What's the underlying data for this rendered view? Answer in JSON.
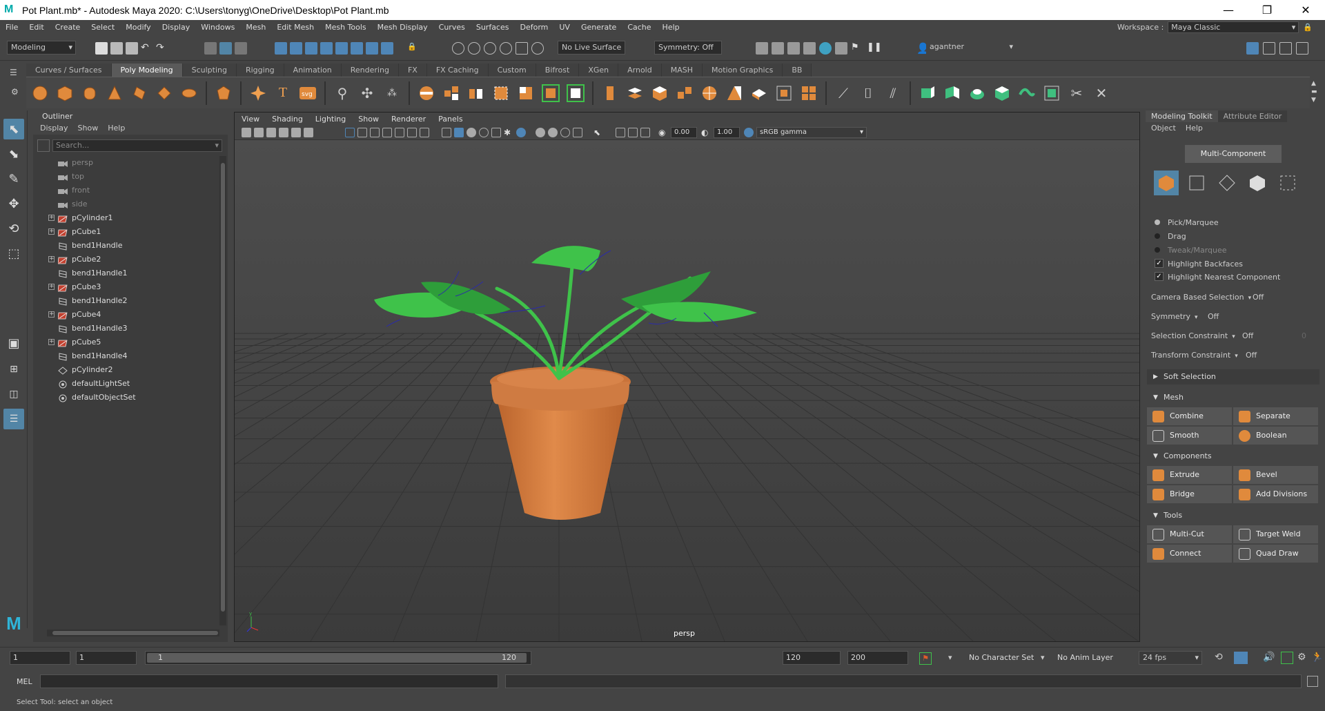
{
  "window": {
    "title": "Pot Plant.mb* - Autodesk Maya 2020: C:\\Users\\tonyg\\OneDrive\\Desktop\\Pot Plant.mb",
    "minimize": "—",
    "maximize": "❐",
    "close": "✕"
  },
  "main_menu": [
    "File",
    "Edit",
    "Create",
    "Select",
    "Modify",
    "Display",
    "Windows",
    "Mesh",
    "Edit Mesh",
    "Mesh Tools",
    "Mesh Display",
    "Curves",
    "Surfaces",
    "Deform",
    "UV",
    "Generate",
    "Cache",
    "Help"
  ],
  "workspace": {
    "label": "Workspace :",
    "value": "Maya Classic"
  },
  "status_line": {
    "menu_set": "Modeling",
    "live_surface": "No Live Surface",
    "symmetry": "Symmetry: Off",
    "user": "agantner"
  },
  "shelf_tabs": [
    "Curves / Surfaces",
    "Poly Modeling",
    "Sculpting",
    "Rigging",
    "Animation",
    "Rendering",
    "FX",
    "FX Caching",
    "Custom",
    "Bifrost",
    "XGen",
    "Arnold",
    "MASH",
    "Motion Graphics",
    "BB"
  ],
  "shelf_active_tab": "Poly Modeling",
  "outliner": {
    "title": "Outliner",
    "menu": [
      "Display",
      "Show",
      "Help"
    ],
    "search_placeholder": "Search...",
    "items": [
      {
        "label": "persp",
        "type": "camera",
        "expand": false
      },
      {
        "label": "top",
        "type": "camera",
        "expand": false
      },
      {
        "label": "front",
        "type": "camera",
        "expand": false
      },
      {
        "label": "side",
        "type": "camera",
        "expand": false
      },
      {
        "label": "pCylinder1",
        "type": "mesh",
        "expand": true
      },
      {
        "label": "pCube1",
        "type": "mesh",
        "expand": true
      },
      {
        "label": "bend1Handle",
        "type": "handle",
        "expand": false
      },
      {
        "label": "pCube2",
        "type": "mesh",
        "expand": true
      },
      {
        "label": "bend1Handle1",
        "type": "handle",
        "expand": false
      },
      {
        "label": "pCube3",
        "type": "mesh",
        "expand": true
      },
      {
        "label": "bend1Handle2",
        "type": "handle",
        "expand": false
      },
      {
        "label": "pCube4",
        "type": "mesh",
        "expand": true
      },
      {
        "label": "bend1Handle3",
        "type": "handle",
        "expand": false
      },
      {
        "label": "pCube5",
        "type": "mesh",
        "expand": true
      },
      {
        "label": "bend1Handle4",
        "type": "handle",
        "expand": false
      },
      {
        "label": "pCylinder2",
        "type": "group",
        "expand": false
      },
      {
        "label": "defaultLightSet",
        "type": "set",
        "expand": false
      },
      {
        "label": "defaultObjectSet",
        "type": "set",
        "expand": false
      }
    ]
  },
  "viewport": {
    "menu": [
      "View",
      "Shading",
      "Lighting",
      "Show",
      "Renderer",
      "Panels"
    ],
    "exposure": "0.00",
    "gamma": "1.00",
    "color_space": "sRGB gamma",
    "camera_label": "persp"
  },
  "toolkit": {
    "tabs": [
      "Modeling Toolkit",
      "Attribute Editor"
    ],
    "menu": [
      "Object",
      "Help"
    ],
    "multi_component": "Multi-Component",
    "pick_modes": [
      "Pick/Marquee",
      "Drag",
      "Tweak/Marquee"
    ],
    "checks": [
      "Highlight Backfaces",
      "Highlight Nearest Component"
    ],
    "options": [
      {
        "label": "Camera Based Selection",
        "value": "Off"
      },
      {
        "label": "Symmetry",
        "value": "Off"
      },
      {
        "label": "Selection Constraint",
        "value": "Off",
        "extra": "0"
      },
      {
        "label": "Transform Constraint",
        "value": "Off"
      }
    ],
    "soft_selection": "Soft Selection",
    "sections": {
      "mesh": {
        "title": "Mesh",
        "buttons": [
          "Combine",
          "Separate",
          "Smooth",
          "Boolean"
        ]
      },
      "components": {
        "title": "Components",
        "buttons": [
          "Extrude",
          "Bevel",
          "Bridge",
          "Add Divisions"
        ]
      },
      "tools": {
        "title": "Tools",
        "buttons": [
          "Multi-Cut",
          "Target Weld",
          "Connect",
          "Quad Draw"
        ]
      }
    }
  },
  "timeline": {
    "start": "1",
    "current": "1",
    "range_start": "1",
    "range_end": "120",
    "end": "120",
    "anim_end": "200",
    "character_set": "No Character Set",
    "anim_layer": "No Anim Layer",
    "fps": "24 fps"
  },
  "command_line": {
    "label": "MEL"
  },
  "help_line": "Select Tool: select an object",
  "colors": {
    "leaf": "#3fc24a",
    "pot": "#d37a3c",
    "accent": "#5285a6"
  }
}
